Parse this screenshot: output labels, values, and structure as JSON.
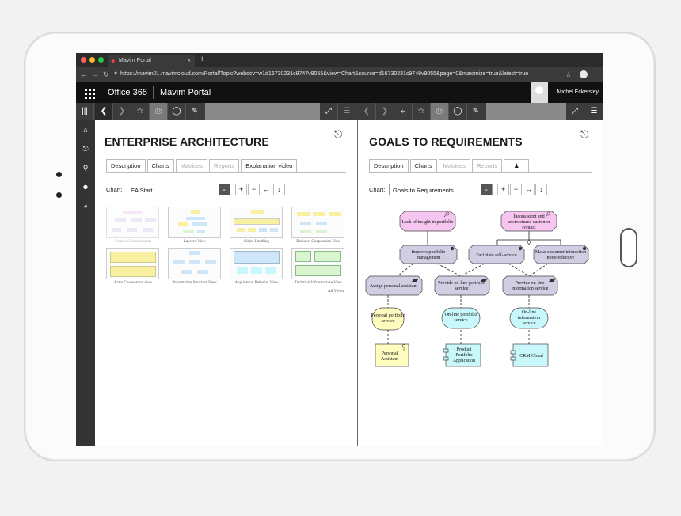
{
  "browser": {
    "tab_title": "Mavim Portal",
    "url": "https://mavim01.mavimcloud.com/Portal/Topic?webdcv=w1d16730231c9747v9055&view=Chart&source=d16730231c9748v9055&page=0&maximize=true&latest=true"
  },
  "o365": {
    "app_name": "Office 365",
    "portal_name": "Mavim Portal",
    "user_name": "Michel Eckersley"
  },
  "left_pane": {
    "title": "ENTERPRISE ARCHITECTURE",
    "tabs": [
      "Description",
      "Charts",
      "Matrices",
      "Reports",
      "Explanation video"
    ],
    "chart_label": "Chart:",
    "chart_value": "EA Start",
    "thumbnails": [
      "Goals to Requirements",
      "Layered View",
      "Claim Handling",
      "Business Cooperation View",
      "Actor Cooperation view",
      "Information Structure View",
      "Application Behavior View",
      "Technical Infrastructure View"
    ],
    "all_views": "All Views"
  },
  "right_pane": {
    "title": "GOALS TO REQUIREMENTS",
    "tabs": [
      "Description",
      "Charts",
      "Matrices",
      "Reports"
    ],
    "chart_label": "Chart:",
    "chart_value": "Goals to Requirements",
    "nodes": {
      "lack": "Lack of insight in portfolio",
      "inconsistent1": "Inconsistent and",
      "inconsistent2": "unstructured customer",
      "inconsistent3": "contact",
      "improve1": "Improve portfolio",
      "improve2": "management",
      "facilitate": "Facilitate self-service",
      "make1": "Make customer interaction",
      "make2": "more effective",
      "assign": "Assign personal assistant",
      "provport1": "Provide on-line portfolio",
      "provport2": "service",
      "provinfo1": "Provide on-line",
      "provinfo2": "information service",
      "perserv1": "Personal portfolio",
      "perserv2": "service",
      "onport1": "On-line portfolio",
      "onport2": "service",
      "oninfo1": "On-line",
      "oninfo2": "information",
      "oninfo3": "service",
      "pa1": "Personal",
      "pa2": "Assistant",
      "ppa1": "Product",
      "ppa2": "Portfolio",
      "ppa3": "Application",
      "crm": "CRM Cloud"
    }
  },
  "colors": {
    "goal_pink": "#f6c6f0",
    "req_purple": "#d2cde3",
    "service_yellow": "#fffcc0",
    "service_cyan": "#c8f8fb",
    "component_cyan": "#c8f8fb"
  }
}
